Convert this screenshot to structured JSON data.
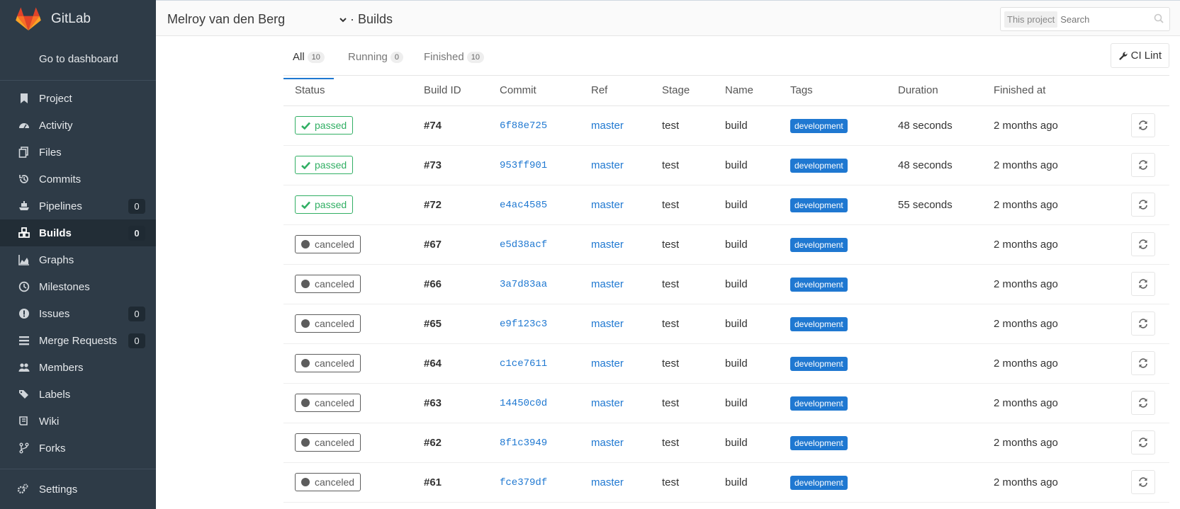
{
  "app": {
    "title": "GitLab"
  },
  "sidebar": {
    "dashboard_label": "Go to dashboard",
    "items": [
      {
        "label": "Project",
        "icon": "bookmark-icon",
        "count": null,
        "active": false
      },
      {
        "label": "Activity",
        "icon": "dashboard-icon",
        "count": null,
        "active": false
      },
      {
        "label": "Files",
        "icon": "files-icon",
        "count": null,
        "active": false
      },
      {
        "label": "Commits",
        "icon": "history-icon",
        "count": null,
        "active": false
      },
      {
        "label": "Pipelines",
        "icon": "ship-icon",
        "count": "0",
        "active": false
      },
      {
        "label": "Builds",
        "icon": "cubes-icon",
        "count": "0",
        "active": true
      },
      {
        "label": "Graphs",
        "icon": "area-chart-icon",
        "count": null,
        "active": false
      },
      {
        "label": "Milestones",
        "icon": "clock-icon",
        "count": null,
        "active": false
      },
      {
        "label": "Issues",
        "icon": "exclamation-circle-icon",
        "count": "0",
        "active": false
      },
      {
        "label": "Merge Requests",
        "icon": "list-icon",
        "count": "0",
        "active": false
      },
      {
        "label": "Members",
        "icon": "users-icon",
        "count": null,
        "active": false
      },
      {
        "label": "Labels",
        "icon": "tags-icon",
        "count": null,
        "active": false
      },
      {
        "label": "Wiki",
        "icon": "book-icon",
        "count": null,
        "active": false
      },
      {
        "label": "Forks",
        "icon": "code-fork-icon",
        "count": null,
        "active": false
      }
    ],
    "settings_label": "Settings"
  },
  "header": {
    "group": "Melroy van den Berg",
    "page": "· Builds",
    "search_scope": "This project",
    "search_placeholder": "Search"
  },
  "tabs": [
    {
      "label": "All",
      "count": "10",
      "active": true
    },
    {
      "label": "Running",
      "count": "0",
      "active": false
    },
    {
      "label": "Finished",
      "count": "10",
      "active": false
    }
  ],
  "ci_lint_label": "CI Lint",
  "table": {
    "columns": [
      "Status",
      "Build ID",
      "Commit",
      "Ref",
      "Stage",
      "Name",
      "Tags",
      "Duration",
      "Finished at"
    ],
    "rows": [
      {
        "status": "passed",
        "id": "#74",
        "commit": "6f88e725",
        "ref": "master",
        "stage": "test",
        "name": "build",
        "tag": "development",
        "duration": "48 seconds",
        "finished": "2 months ago"
      },
      {
        "status": "passed",
        "id": "#73",
        "commit": "953ff901",
        "ref": "master",
        "stage": "test",
        "name": "build",
        "tag": "development",
        "duration": "48 seconds",
        "finished": "2 months ago"
      },
      {
        "status": "passed",
        "id": "#72",
        "commit": "e4ac4585",
        "ref": "master",
        "stage": "test",
        "name": "build",
        "tag": "development",
        "duration": "55 seconds",
        "finished": "2 months ago"
      },
      {
        "status": "canceled",
        "id": "#67",
        "commit": "e5d38acf",
        "ref": "master",
        "stage": "test",
        "name": "build",
        "tag": "development",
        "duration": "",
        "finished": "2 months ago"
      },
      {
        "status": "canceled",
        "id": "#66",
        "commit": "3a7d83aa",
        "ref": "master",
        "stage": "test",
        "name": "build",
        "tag": "development",
        "duration": "",
        "finished": "2 months ago"
      },
      {
        "status": "canceled",
        "id": "#65",
        "commit": "e9f123c3",
        "ref": "master",
        "stage": "test",
        "name": "build",
        "tag": "development",
        "duration": "",
        "finished": "2 months ago"
      },
      {
        "status": "canceled",
        "id": "#64",
        "commit": "c1ce7611",
        "ref": "master",
        "stage": "test",
        "name": "build",
        "tag": "development",
        "duration": "",
        "finished": "2 months ago"
      },
      {
        "status": "canceled",
        "id": "#63",
        "commit": "14450c0d",
        "ref": "master",
        "stage": "test",
        "name": "build",
        "tag": "development",
        "duration": "",
        "finished": "2 months ago"
      },
      {
        "status": "canceled",
        "id": "#62",
        "commit": "8f1c3949",
        "ref": "master",
        "stage": "test",
        "name": "build",
        "tag": "development",
        "duration": "",
        "finished": "2 months ago"
      },
      {
        "status": "canceled",
        "id": "#61",
        "commit": "fce379df",
        "ref": "master",
        "stage": "test",
        "name": "build",
        "tag": "development",
        "duration": "",
        "finished": "2 months ago"
      }
    ]
  },
  "colors": {
    "sidebar_bg": "#2e3b47",
    "link": "#1f78d1",
    "passed": "#31af64",
    "canceled": "#5c5c5c"
  }
}
